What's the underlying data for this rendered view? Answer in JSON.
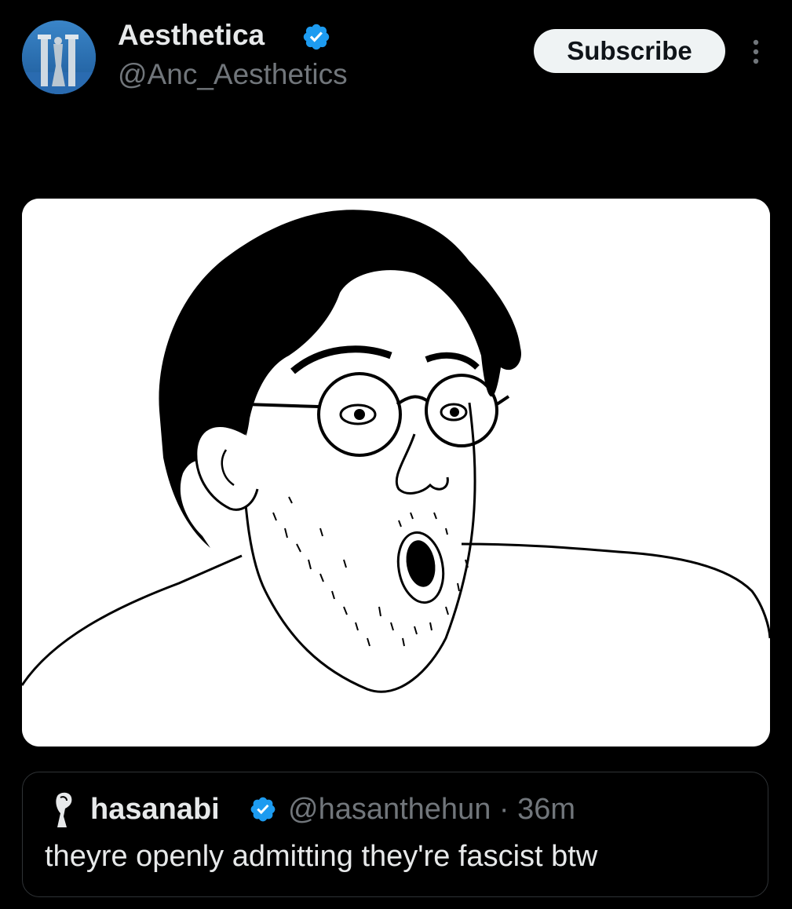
{
  "post": {
    "author": {
      "name": "Aesthetica",
      "handle": "@Anc_Aesthetics",
      "verified": true,
      "avatar_icon": "column-statue-avatar"
    },
    "subscribe_label": "Subscribe",
    "more_icon": "vertical-ellipsis-icon",
    "media": {
      "icon": "wojak-surprised-drawing"
    }
  },
  "quoted_post": {
    "author": {
      "name": "hasanabi",
      "handle": "@hasanthehun",
      "verified": true
    },
    "separator": "·",
    "time": "36m",
    "text": "theyre openly admitting they're fascist btw"
  },
  "colors": {
    "background": "#000000",
    "primary_text": "#e7e9ea",
    "secondary_text": "#71767b",
    "verified_blue": "#1d9bf0",
    "button_bg": "#eff3f4"
  }
}
